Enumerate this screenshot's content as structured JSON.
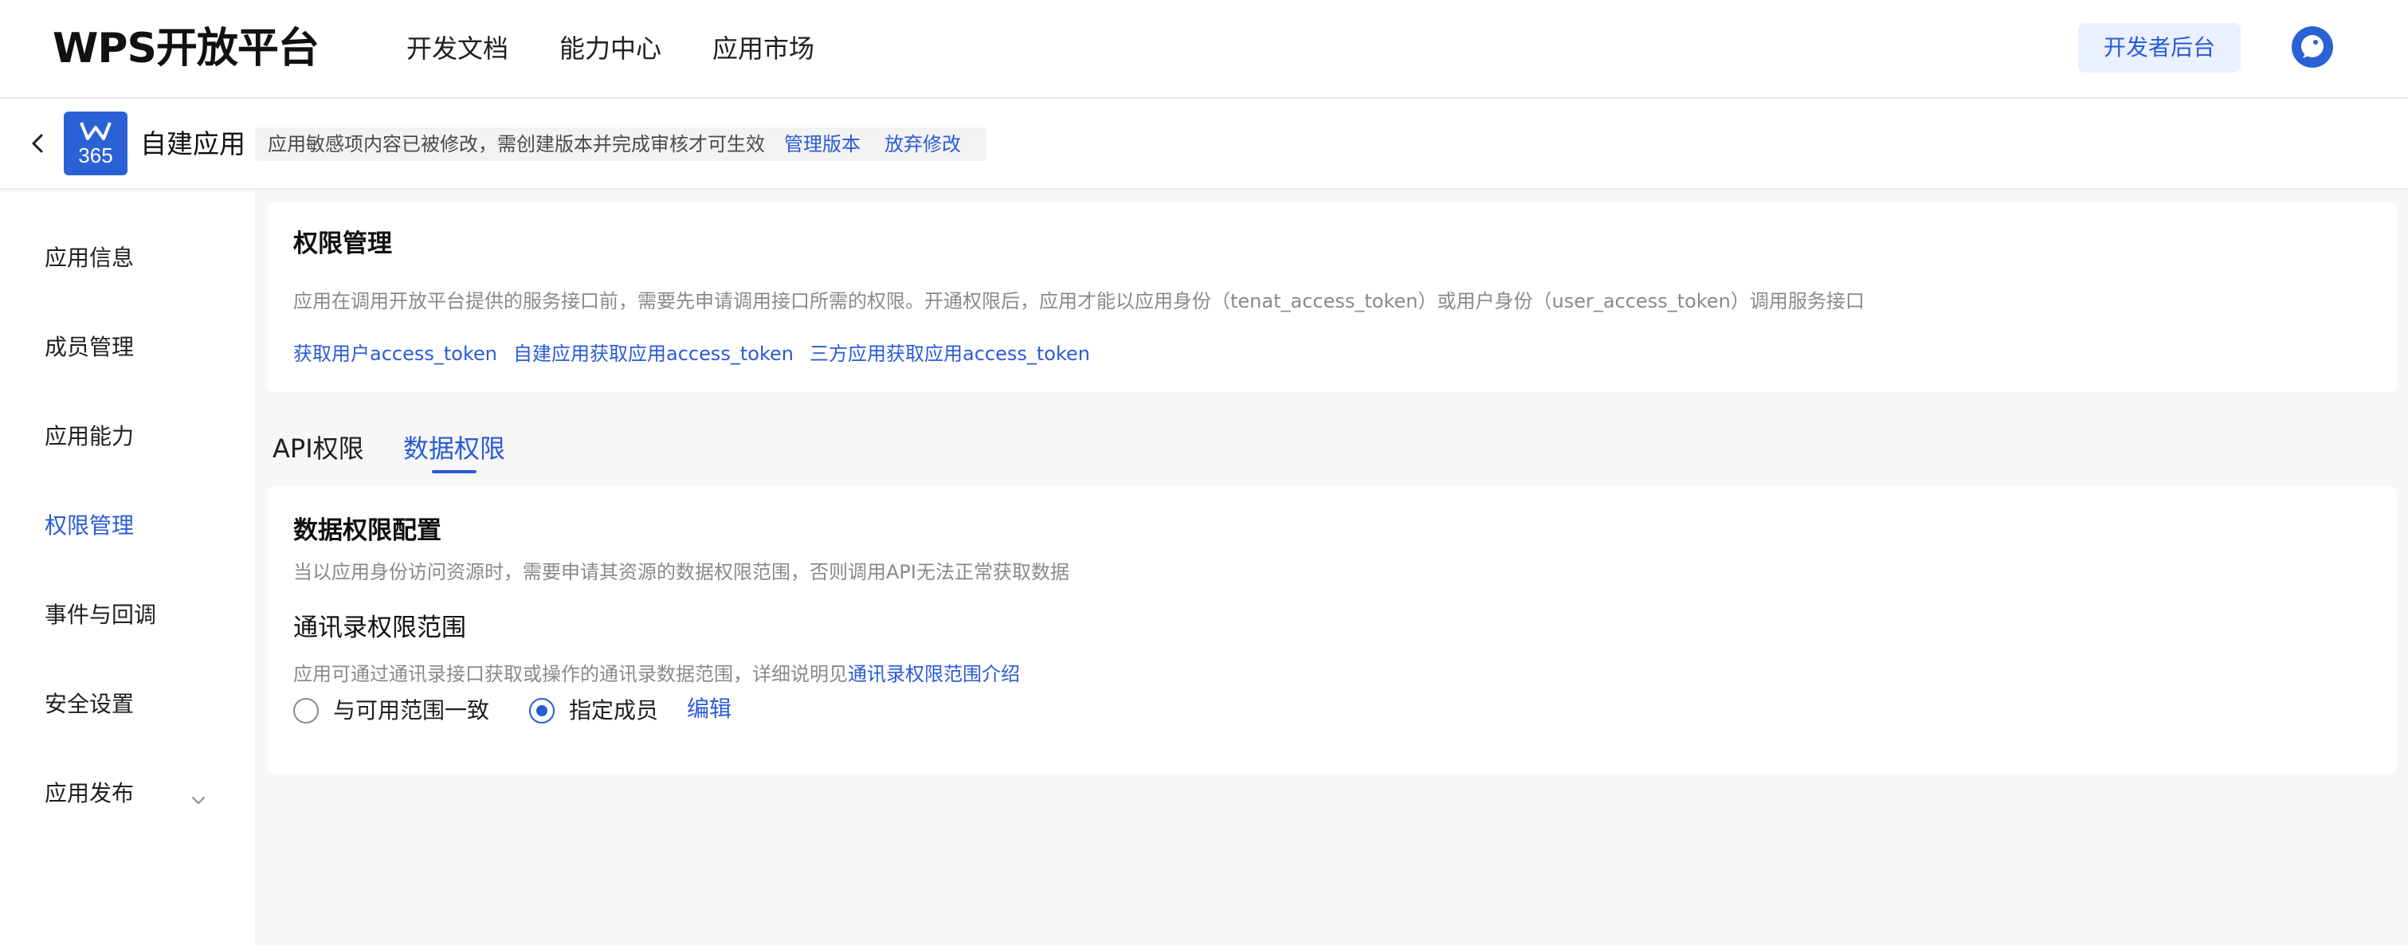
{
  "header": {
    "brand": "WPS开放平台",
    "nav": [
      "开发文档",
      "能力中心",
      "应用市场"
    ],
    "dev_console": "开发者后台"
  },
  "subheader": {
    "app_name": "自建应用",
    "logo_text": "365",
    "notice": "应用敏感项内容已被修改，需创建版本并完成审核才可生效",
    "manage_version": "管理版本",
    "discard_changes": "放弃修改"
  },
  "sidebar": {
    "items": [
      {
        "label": "应用信息",
        "active": false
      },
      {
        "label": "成员管理",
        "active": false
      },
      {
        "label": "应用能力",
        "active": false
      },
      {
        "label": "权限管理",
        "active": true
      },
      {
        "label": "事件与回调",
        "active": false
      },
      {
        "label": "安全设置",
        "active": false
      },
      {
        "label": "应用发布",
        "active": false
      }
    ]
  },
  "permission": {
    "title": "权限管理",
    "description": "应用在调用开放平台提供的服务接口前，需要先申请调用接口所需的权限。开通权限后，应用才能以应用身份（tenat_access_token）或用户身份（user_access_token）调用服务接口",
    "links": [
      "获取用户access_token",
      "自建应用获取应用access_token",
      "三方应用获取应用access_token"
    ]
  },
  "tabs": [
    {
      "label": "API权限",
      "active": false
    },
    {
      "label": "数据权限",
      "active": true
    }
  ],
  "data_permission": {
    "title": "数据权限配置",
    "description": "当以应用身份访问资源时，需要申请其资源的数据权限范围，否则调用API无法正常获取数据",
    "contacts_title": "通讯录权限范围",
    "contacts_desc": "应用可通过通讯录接口获取或操作的通讯录数据范围，详细说明见",
    "contacts_link": "通讯录权限范围介绍",
    "options": [
      {
        "label": "与可用范围一致",
        "checked": false
      },
      {
        "label": "指定成员",
        "checked": true
      }
    ],
    "edit": "编辑"
  },
  "colors": {
    "accent": "#2a5bd7",
    "logo_bg": "#2a62d6",
    "button_bg": "#eaf0fd"
  }
}
